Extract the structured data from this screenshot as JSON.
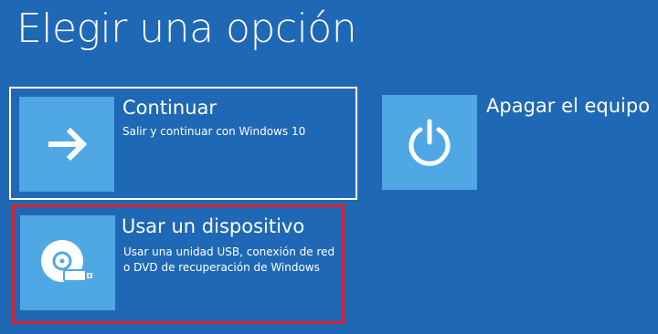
{
  "page": {
    "title": "Elegir una opción"
  },
  "options": [
    {
      "label": "Continuar",
      "description": [
        "Salir y continuar con Windows 10"
      ],
      "icon": "arrow-right-icon"
    },
    {
      "label": "Apagar el equipo",
      "description": [],
      "icon": "power-icon"
    },
    {
      "label": "Usar un dispositivo",
      "description": [
        "Usar una unidad USB, conexión de red",
        "o DVD de recuperación de Windows"
      ],
      "icon": "disc-usb-icon"
    }
  ],
  "colors": {
    "background": "#1f68b5",
    "tile": "#4fa7e3",
    "focus_border": "#ffffff",
    "highlight_border": "#e01f27"
  }
}
